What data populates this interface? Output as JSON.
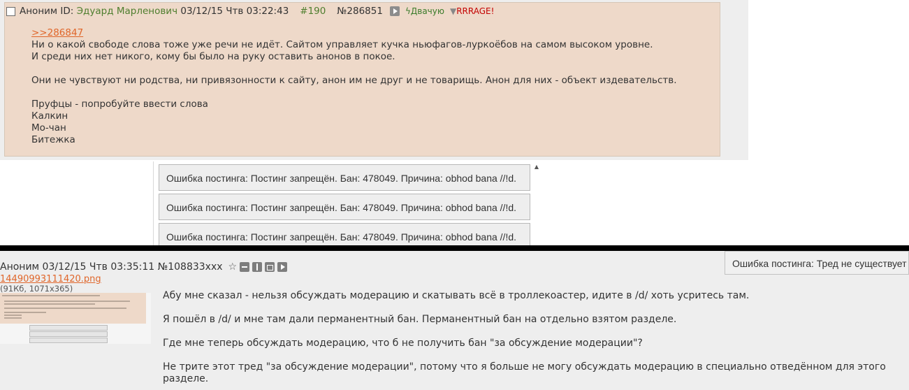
{
  "post1": {
    "name": "Аноним ID:",
    "id_name": "Эдуард Марленович",
    "date": "03/12/15 Чтв 03:22:43",
    "index": "#190",
    "number": "№286851",
    "dvachuyu": "Двачую",
    "rrrage": "RRRAGE!",
    "reply_link": ">>286847",
    "lines": [
      "Ни о какой свободе слова тоже уже речи не идёт. Сайтом управляет кучка ньюфагов-луркоёбов на самом высоком уровне.",
      "И среди них нет никого, кому бы было на руку оставить анонов в покое.",
      "",
      "Они не чувствуют ни родства, ни привязонности к сайту, анон им не друг и не товарищь. Анон для них - объект издевательств.",
      "",
      "Пруфцы - попробуйте ввести слова",
      "Калкин",
      "Мо-чан",
      "Битежка"
    ]
  },
  "errors": [
    "Ошибка постинга: Постинг запрещён. Бан: 478049. Причина: obhod bana //!d.",
    "Ошибка постинга: Постинг запрещён. Бан: 478049. Причина: obhod bana //!d.",
    "Ошибка постинга: Постинг запрещён. Бан: 478049. Причина: obhod bana //!d."
  ],
  "side_error": "Ошибка постинга: Тред не существует",
  "post2": {
    "header": "Аноним 03/12/15 Чтв 03:35:11 №108833xxx",
    "file_name": "14490993111420.png",
    "file_meta": "(91Кб, 1071x365)",
    "paragraphs": [
      "Абу мне сказал - нельзя обсуждать модерацию и скатывать всё в троллекоастер, идите в /d/ хоть усритесь там.",
      "Я пошёл в /d/ и мне там дали перманентный бан. Перманентный бан на отдельно взятом разделе.",
      "Где мне теперь обсуждать модерацию, что б не получить бан \"за обсуждение модерации\"?",
      "Не трите этот тред \"за обсуждение модерации\", потому что я больше не могу обсуждать модерацию в специально отведённом для этого разделе."
    ]
  },
  "colors": {
    "post_bg": "#eed9c9",
    "page_bg": "#eeeeee",
    "link": "#e0662a",
    "id_green": "#4e7e2e",
    "rage_red": "#c30000"
  }
}
